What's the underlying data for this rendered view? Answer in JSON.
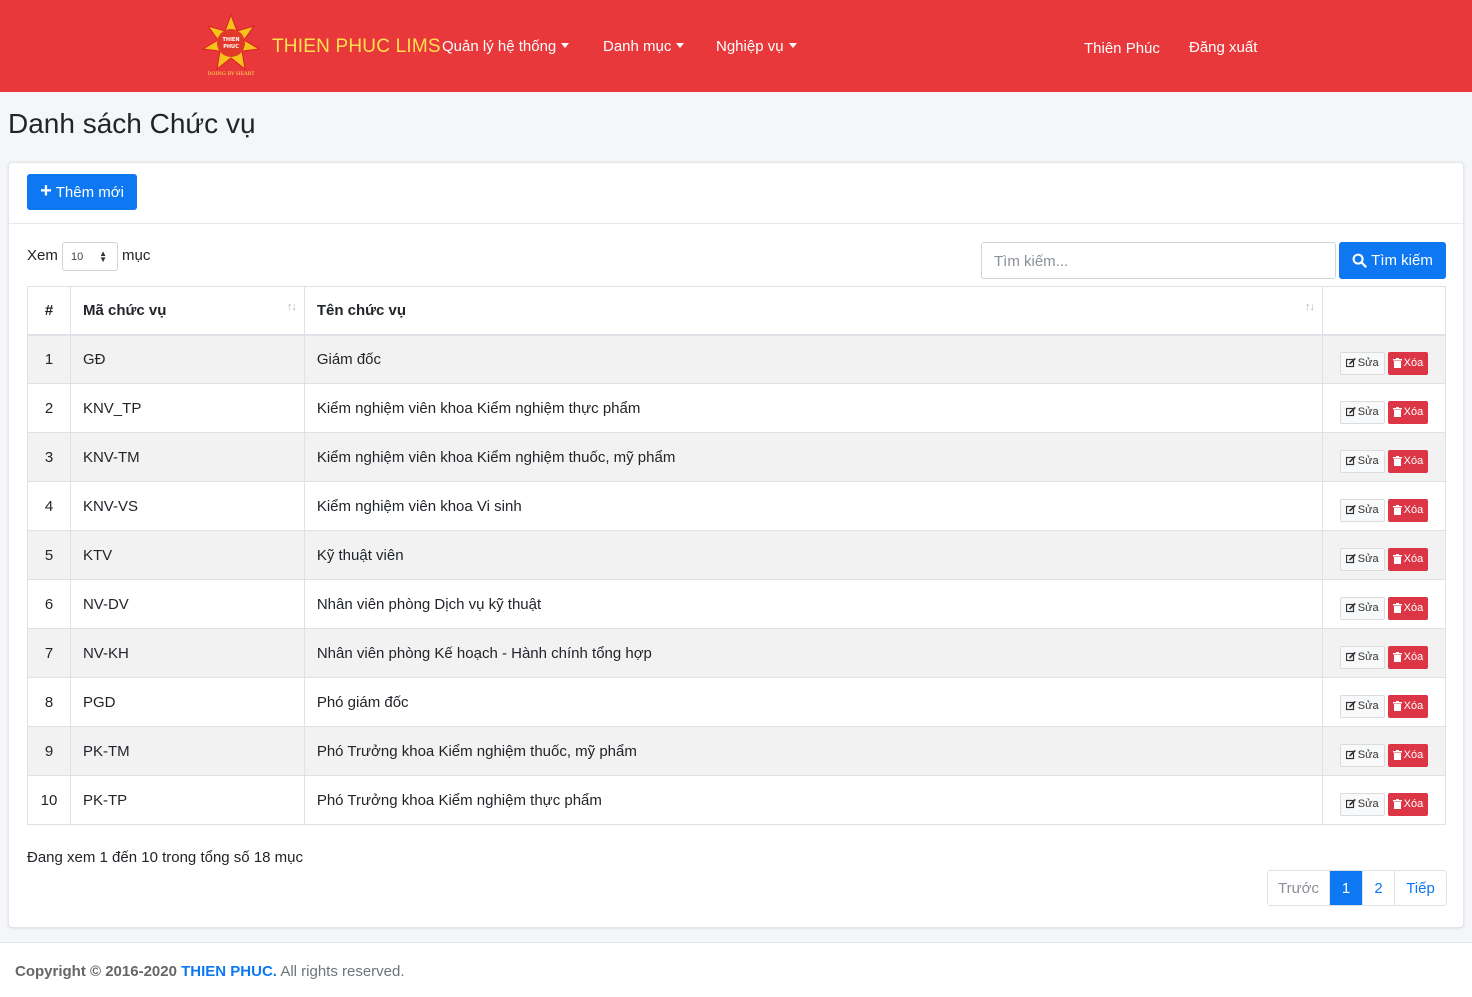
{
  "navbar": {
    "logo_text": "THIEN PHUC",
    "logo_slogan": "DOING BY HEART",
    "brand": "THIEN PHUC LIMS",
    "menus": [
      {
        "label": "Quản lý hệ thống"
      },
      {
        "label": "Danh mục"
      },
      {
        "label": "Nghiệp vụ"
      }
    ],
    "user": "Thiên Phúc",
    "logout": "Đăng xuất",
    "bg_color": "#e8383b"
  },
  "page": {
    "title": "Danh sách Chức vụ",
    "add_button": "Thêm mới",
    "show_prefix": "Xem",
    "page_size": "10",
    "show_suffix": "mục",
    "search_placeholder": "Tìm kiếm...",
    "search_button": "Tìm kiếm"
  },
  "table": {
    "headers": {
      "index": "#",
      "code": "Mã chức vụ",
      "name": "Tên chức vụ"
    },
    "edit_label": "Sửa",
    "delete_label": "Xóa",
    "rows": [
      {
        "index": "1",
        "code": "GĐ",
        "name": "Giám đốc"
      },
      {
        "index": "2",
        "code": "KNV_TP",
        "name": "Kiểm nghiệm viên khoa Kiểm nghiệm thực phẩm"
      },
      {
        "index": "3",
        "code": "KNV-TM",
        "name": "Kiểm nghiệm viên khoa Kiểm nghiệm thuốc, mỹ phẩm"
      },
      {
        "index": "4",
        "code": "KNV-VS",
        "name": "Kiểm nghiệm viên khoa Vi sinh"
      },
      {
        "index": "5",
        "code": "KTV",
        "name": "Kỹ thuật viên"
      },
      {
        "index": "6",
        "code": "NV-DV",
        "name": "Nhân viên phòng Dịch vụ kỹ thuật"
      },
      {
        "index": "7",
        "code": "NV-KH",
        "name": "Nhân viên phòng Kế hoạch - Hành chính tổng hợp"
      },
      {
        "index": "8",
        "code": "PGD",
        "name": "Phó giám đốc"
      },
      {
        "index": "9",
        "code": "PK-TM",
        "name": "Phó Trưởng khoa Kiểm nghiệm thuốc, mỹ phẩm"
      },
      {
        "index": "10",
        "code": "PK-TP",
        "name": "Phó Trưởng khoa Kiểm nghiệm thực phẩm"
      }
    ]
  },
  "pagination": {
    "info": "Đang xem 1 đến 10 trong tổng số 18 mục",
    "prev": "Trước",
    "pages": [
      "1",
      "2"
    ],
    "current": "1",
    "next": "Tiếp"
  },
  "footer": {
    "prefix": "Copyright © 2016-2020",
    "brand": "THIEN PHUC.",
    "suffix": "All rights reserved."
  },
  "colors": {
    "primary": "#0d78f2",
    "danger": "#dc3545"
  }
}
